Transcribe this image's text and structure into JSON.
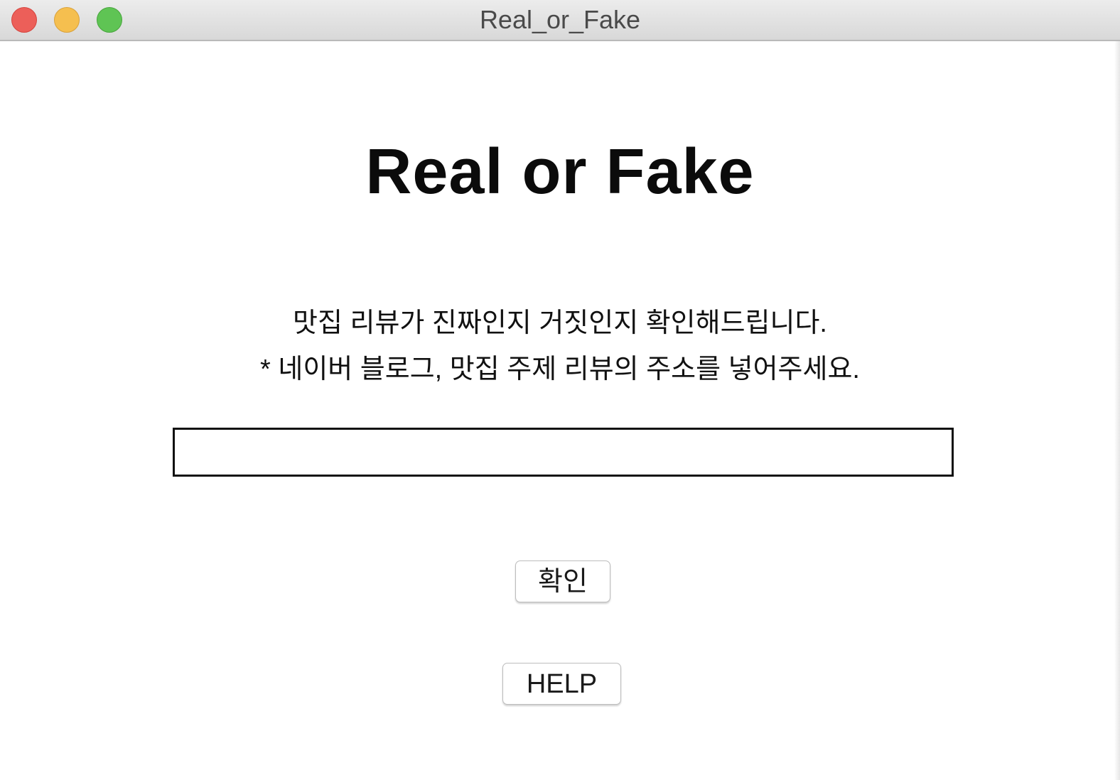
{
  "window": {
    "title": "Real_or_Fake"
  },
  "main": {
    "title": "Real or Fake",
    "description_line1": "맛집 리뷰가 진짜인지 거짓인지 확인해드립니다.",
    "description_line2": "* 네이버 블로그, 맛집 주제 리뷰의 주소를 넣어주세요.",
    "url_input": {
      "value": "",
      "placeholder": ""
    },
    "confirm_label": "확인",
    "help_label": "HELP"
  },
  "colors": {
    "close": "#ec5f59",
    "minimize": "#f5bf4f",
    "zoom": "#5fc454"
  }
}
